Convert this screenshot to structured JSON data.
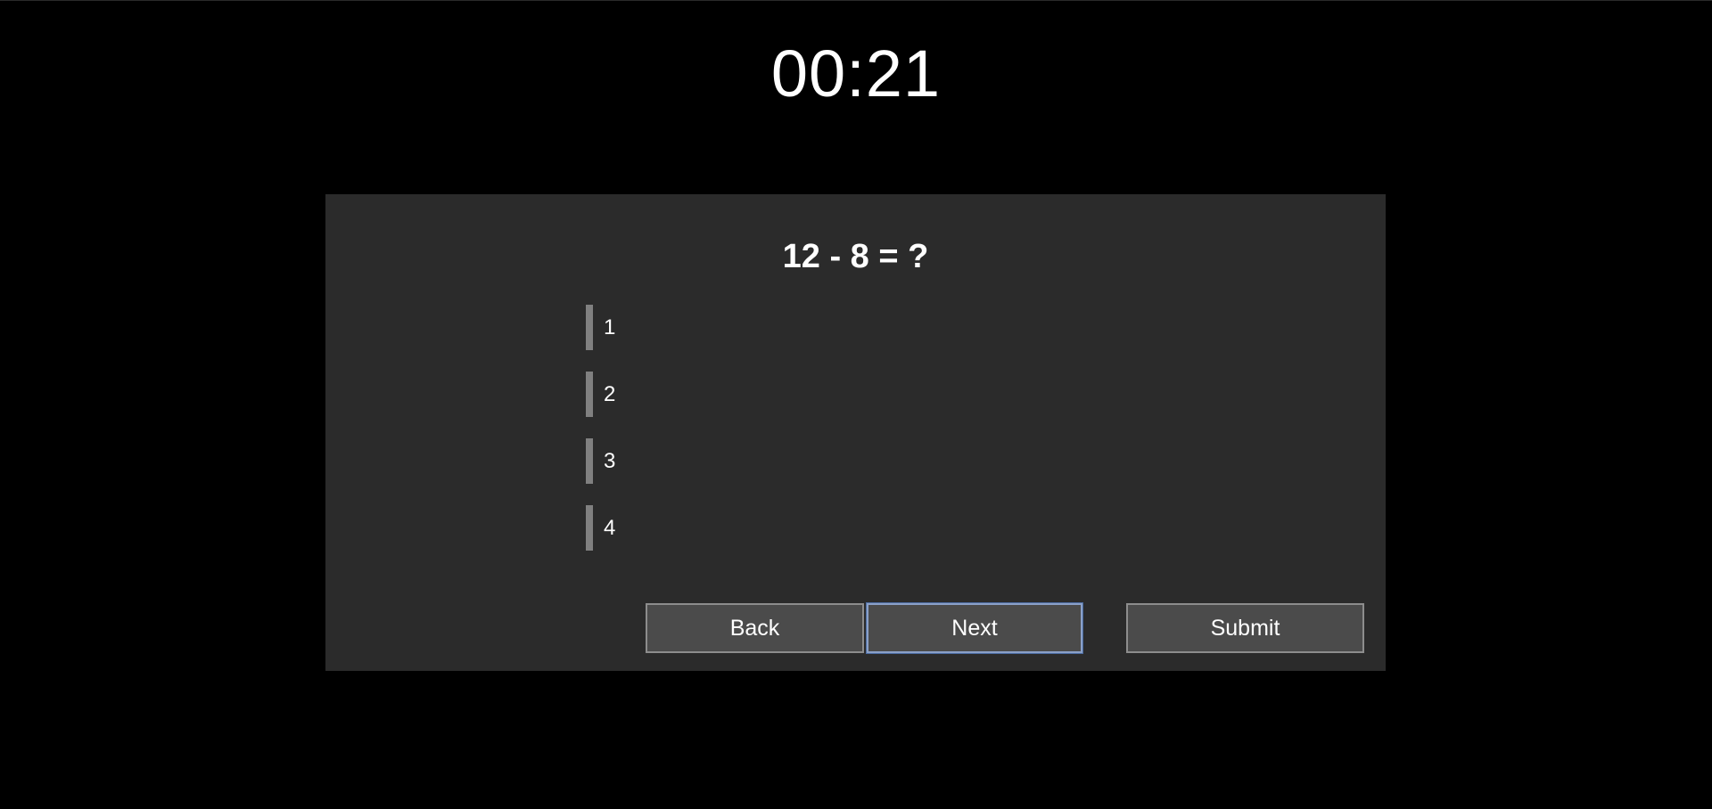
{
  "timer": {
    "value": "00:21"
  },
  "question": {
    "text": "12 - 8 = ?"
  },
  "answers": [
    {
      "label": "1"
    },
    {
      "label": "2"
    },
    {
      "label": "3"
    },
    {
      "label": "4"
    }
  ],
  "buttons": {
    "back_label": "Back",
    "next_label": "Next",
    "submit_label": "Submit"
  },
  "colors": {
    "background": "#000000",
    "panel": "#2b2b2b",
    "answer_bar": "#808080",
    "button": "#4b4b4b",
    "focus_outline": "#8aa0c8"
  }
}
